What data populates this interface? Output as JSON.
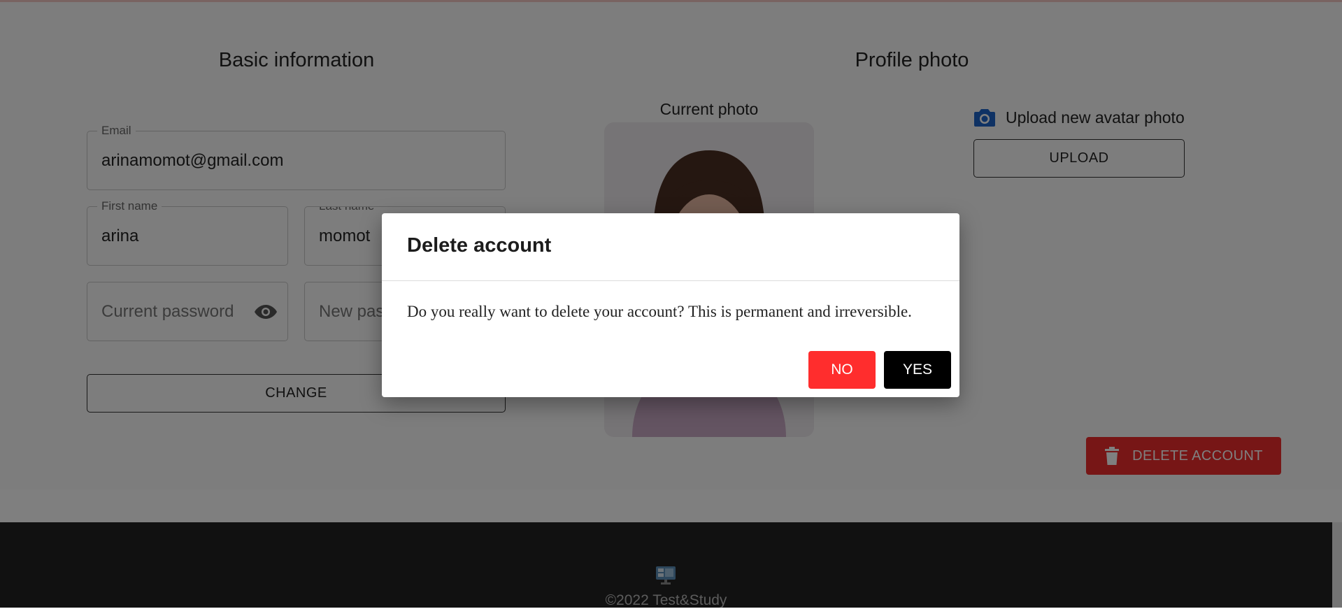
{
  "basic_info": {
    "title": "Basic information",
    "email": {
      "label": "Email",
      "value": "arinamomot@gmail.com"
    },
    "first_name": {
      "label": "First name",
      "value": "arina"
    },
    "last_name": {
      "label": "Last name",
      "value": "momot"
    },
    "current_password": {
      "placeholder": "Current password",
      "icon": "eye-icon"
    },
    "new_password": {
      "placeholder": "New password"
    },
    "change_label": "CHANGE"
  },
  "profile_photo": {
    "title": "Profile photo",
    "current_label": "Current photo",
    "upload_prompt": "Upload new avatar photo",
    "upload_icon": "camera-icon",
    "upload_label": "UPLOAD",
    "delete_label": "DELETE ACCOUNT",
    "delete_icon": "trash-icon"
  },
  "footer": {
    "logo_icon": "computer-icon",
    "copyright": "©2022 Test&Study"
  },
  "dialog": {
    "title": "Delete account",
    "message": "Do you really want to delete your account? This is permanent and irreversible.",
    "no_label": "NO",
    "yes_label": "YES"
  },
  "colors": {
    "danger": "#ef2c2c",
    "icon_blue": "#1e64c8",
    "footer_bg": "#222222"
  }
}
